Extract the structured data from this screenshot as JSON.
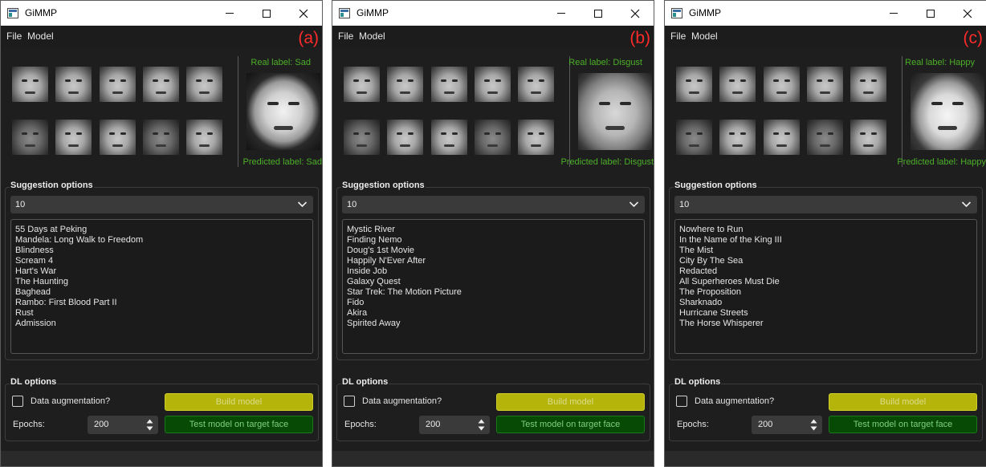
{
  "colors": {
    "accent_label": "#4caf28",
    "panel_letter": "#ff2b2b",
    "build_button": "#b5b40a",
    "test_button": "#064a06"
  },
  "windows": [
    {
      "title": "GiMMP",
      "menu": [
        "File",
        "Model"
      ],
      "panel_letter": "(a)",
      "real_label": "Real label: Sad",
      "predicted_label": "Predicted label: Sad",
      "suggestion_title": "Suggestion options",
      "combo_value": "10",
      "suggestions": [
        "55 Days at Peking",
        "Mandela: Long Walk to Freedom",
        "Blindness",
        "Scream 4",
        "Hart's War",
        "The Haunting",
        "Baghead",
        "Rambo: First Blood Part II",
        "Rust",
        "Admission"
      ],
      "dl_title": "DL options",
      "augmentation_label": "Data augmentation?",
      "build_label": "Build model",
      "epochs_label": "Epochs:",
      "epochs_value": "200",
      "test_label": "Test model on target face"
    },
    {
      "title": "GiMMP",
      "menu": [
        "File",
        "Model"
      ],
      "panel_letter": "(b)",
      "real_label": "Real label: Disgust",
      "predicted_label": "Predicted label: Disgust",
      "suggestion_title": "Suggestion options",
      "combo_value": "10",
      "suggestions": [
        "Mystic River",
        "Finding Nemo",
        "Doug's 1st Movie",
        "Happily N'Ever After",
        "Inside Job",
        "Galaxy Quest",
        "Star Trek: The Motion Picture",
        "Fido",
        "Akira",
        "Spirited Away"
      ],
      "dl_title": "DL options",
      "augmentation_label": "Data augmentation?",
      "build_label": "Build model",
      "epochs_label": "Epochs:",
      "epochs_value": "200",
      "test_label": "Test model on target face"
    },
    {
      "title": "GiMMP",
      "menu": [
        "File",
        "Model"
      ],
      "panel_letter": "(c)",
      "real_label": "Real label: Happy",
      "predicted_label": "Predicted label: Happy",
      "suggestion_title": "Suggestion options",
      "combo_value": "10",
      "suggestions": [
        "Nowhere to Run",
        "In the Name of the King III",
        "The Mist",
        "City By The Sea",
        "Redacted",
        "All Superheroes Must Die",
        "The Proposition",
        "Sharknado",
        "Hurricane Streets",
        "The Horse Whisperer"
      ],
      "dl_title": "DL options",
      "augmentation_label": "Data augmentation?",
      "build_label": "Build model",
      "epochs_label": "Epochs:",
      "epochs_value": "200",
      "test_label": "Test model on target face"
    }
  ]
}
